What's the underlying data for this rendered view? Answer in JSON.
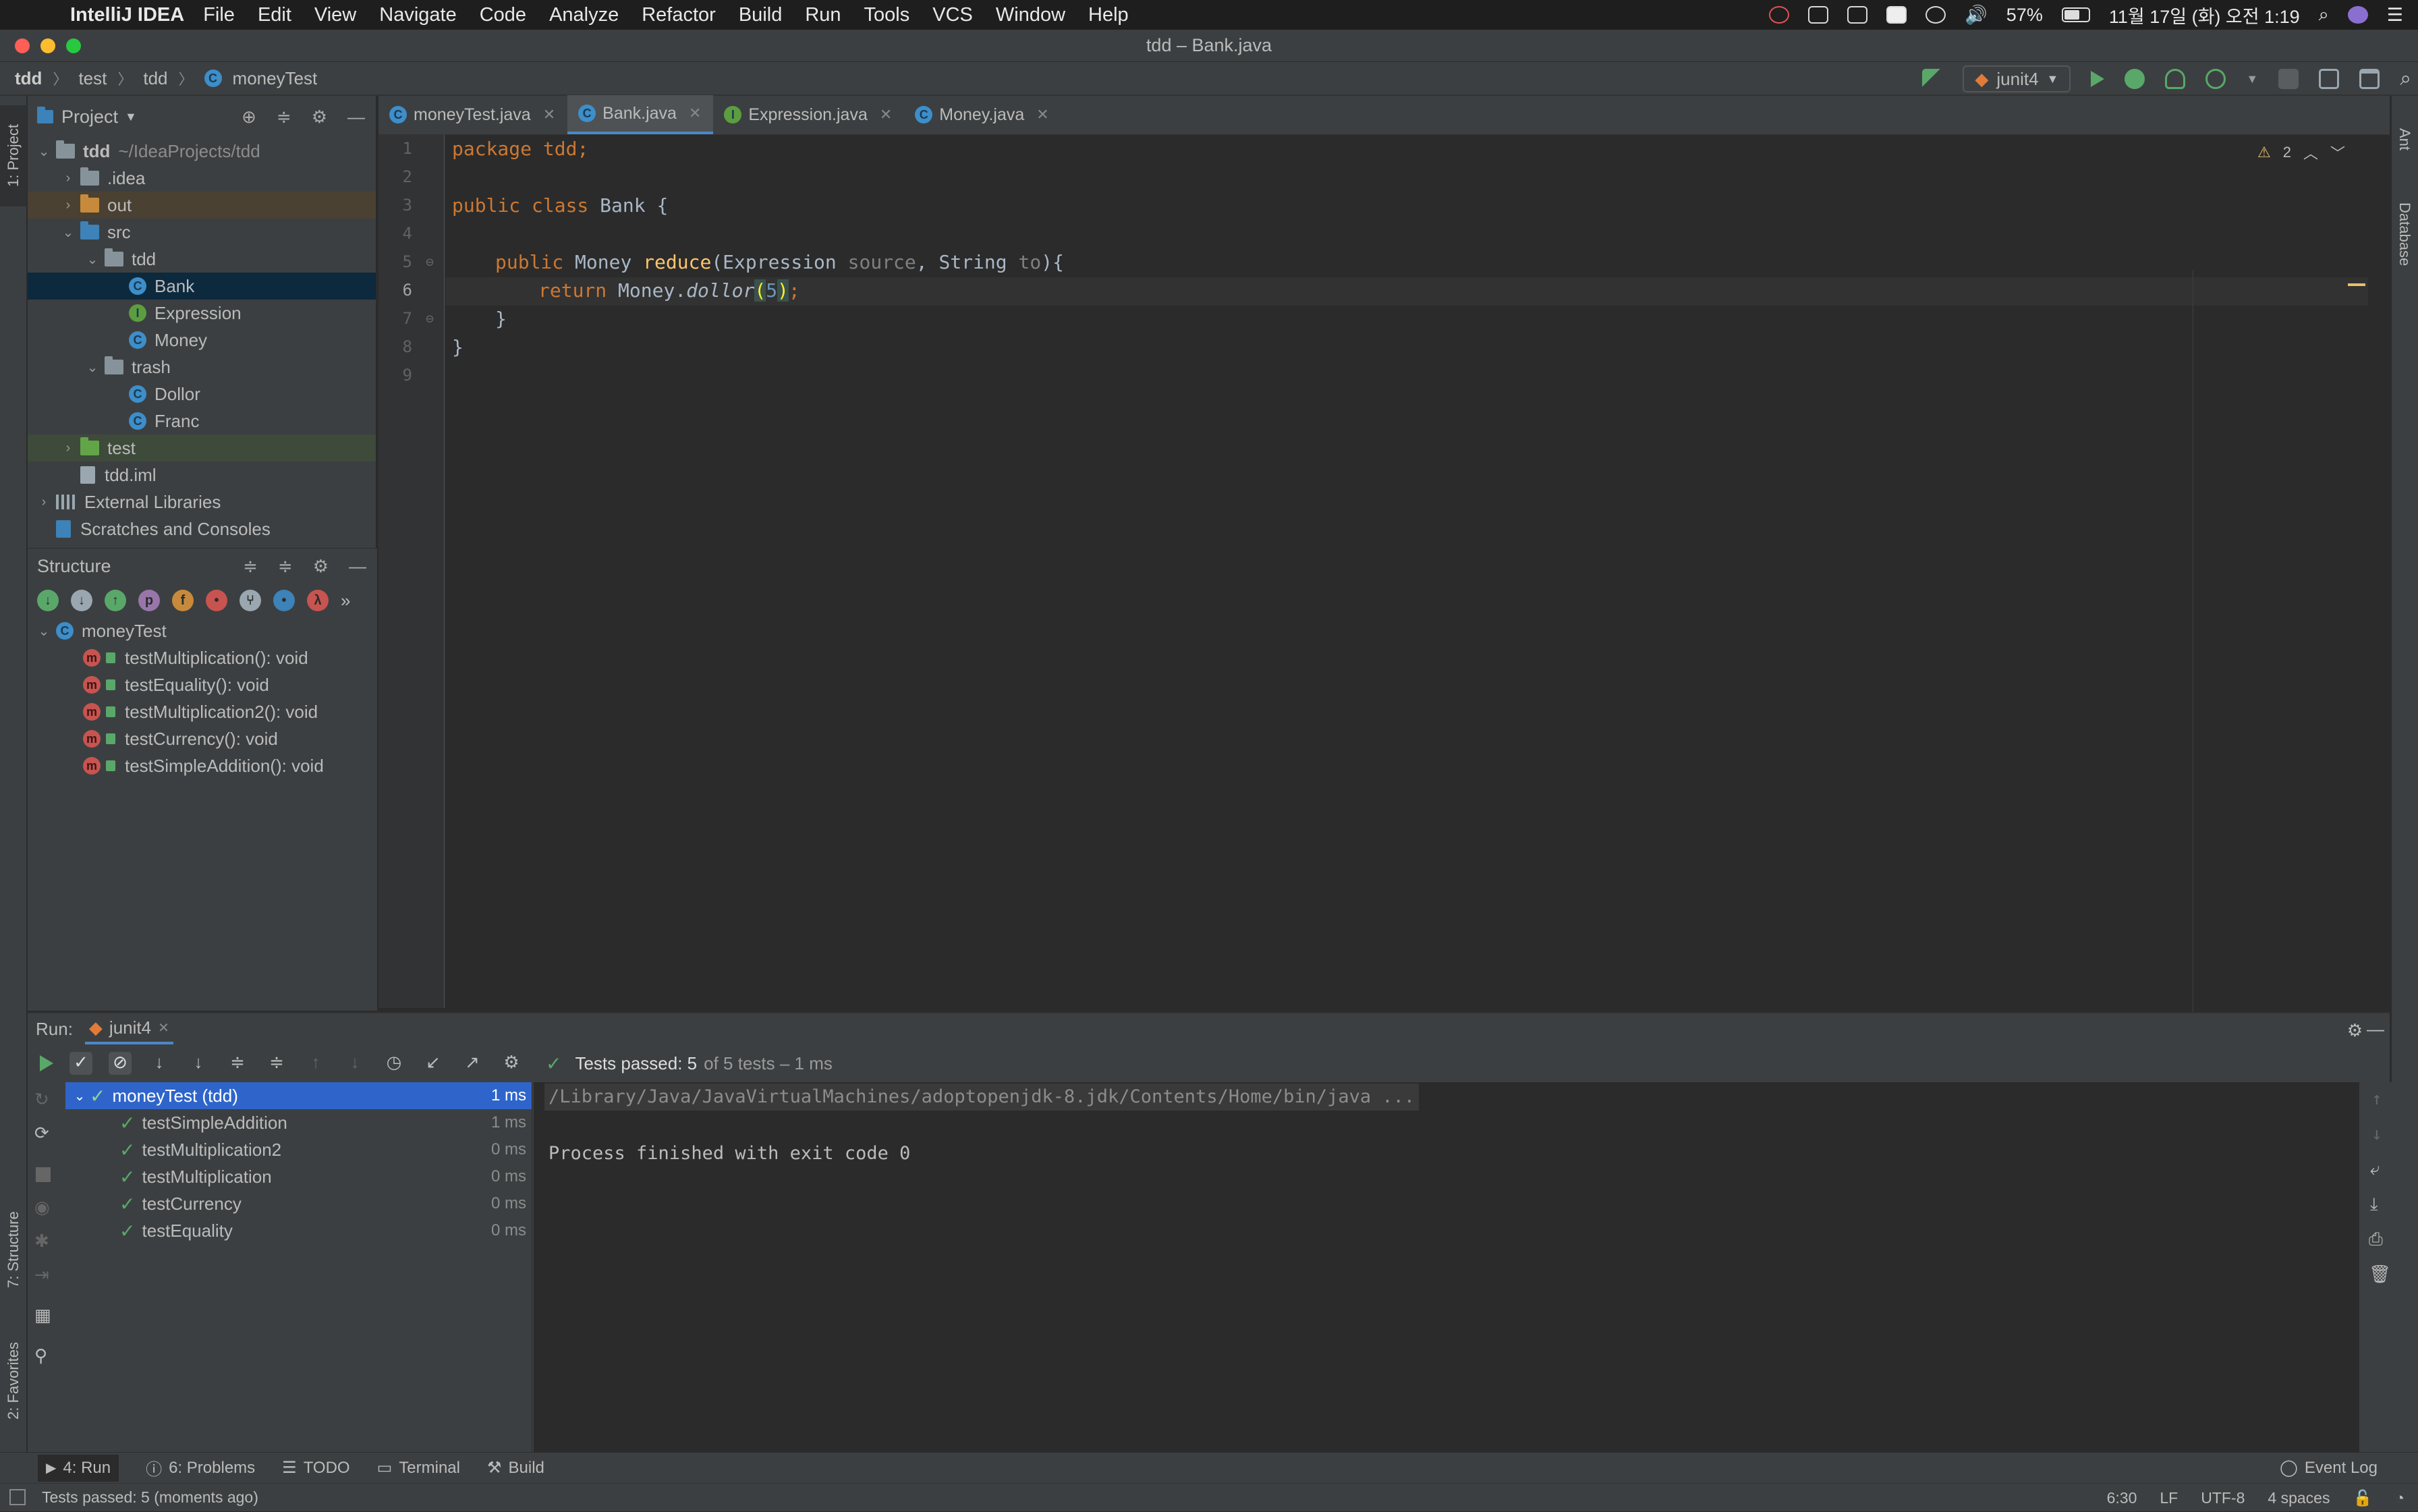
{
  "menubar": {
    "app_name": "IntelliJ IDEA",
    "menus": [
      "File",
      "Edit",
      "View",
      "Navigate",
      "Code",
      "Analyze",
      "Refactor",
      "Build",
      "Run",
      "Tools",
      "VCS",
      "Window",
      "Help"
    ],
    "battery": "57%",
    "clock": "11월 17일 (화) 오전 1:19"
  },
  "window": {
    "title": "tdd – Bank.java"
  },
  "navbar": {
    "breadcrumbs": [
      "tdd",
      "test",
      "tdd",
      "moneyTest"
    ],
    "run_config": "junit4"
  },
  "left_stripe": {
    "project_tab": "1: Project",
    "structure_tab": "7: Structure",
    "favorites_tab": "2: Favorites"
  },
  "right_stripe": {
    "ant_tab": "Ant",
    "database_tab": "Database"
  },
  "project": {
    "title": "Project",
    "root_name": "tdd",
    "root_path": "~/IdeaProjects/tdd",
    "items": {
      "idea": ".idea",
      "out": "out",
      "src": "src",
      "pkg_tdd": "tdd",
      "bank": "Bank",
      "expression": "Expression",
      "money": "Money",
      "trash": "trash",
      "dollor": "Dollor",
      "franc": "Franc",
      "test": "test",
      "iml": "tdd.iml",
      "ext_libs": "External Libraries",
      "scratches": "Scratches and Consoles"
    }
  },
  "structure": {
    "title": "Structure",
    "class_name": "moneyTest",
    "methods": [
      "testMultiplication(): void",
      "testEquality(): void",
      "testMultiplication2(): void",
      "testCurrency(): void",
      "testSimpleAddition(): void"
    ]
  },
  "editor": {
    "tabs": [
      "moneyTest.java",
      "Bank.java",
      "Expression.java",
      "Money.java"
    ],
    "active_tab": "Bank.java",
    "warning_count": "2",
    "line_numbers": [
      "1",
      "2",
      "3",
      "4",
      "5",
      "6",
      "7",
      "8",
      "9"
    ],
    "code": {
      "l1_kw": "package",
      "l1_rest": " tdd;",
      "l3_kw": "public class",
      "l3_rest": " Bank {",
      "l5_kw": "public",
      "l5_type": " Money ",
      "l5_fn": "reduce",
      "l5_a": "(Expression ",
      "l5_p1": "source",
      "l5_b": ", String ",
      "l5_p2": "to",
      "l5_c": "){",
      "l6_kw": "return",
      "l6_a": " Money.",
      "l6_fn": "dollor",
      "l6_open": "(",
      "l6_num": "5",
      "l6_close": ")",
      "l6_end": ";",
      "l7": "}",
      "l8": "}"
    }
  },
  "run": {
    "label": "Run:",
    "tab": "junit4",
    "status_passed": "Tests passed: 5",
    "status_rest": "of 5 tests – 1 ms",
    "root": {
      "name": "moneyTest (tdd)",
      "time": "1 ms"
    },
    "tests": [
      {
        "name": "testSimpleAddition",
        "time": "1 ms"
      },
      {
        "name": "testMultiplication2",
        "time": "0 ms"
      },
      {
        "name": "testMultiplication",
        "time": "0 ms"
      },
      {
        "name": "testCurrency",
        "time": "0 ms"
      },
      {
        "name": "testEquality",
        "time": "0 ms"
      }
    ],
    "console": {
      "cmd": "/Library/Java/JavaVirtualMachines/adoptopenjdk-8.jdk/Contents/Home/bin/java ...",
      "exit": "Process finished with exit code 0"
    }
  },
  "bottom_tabs": {
    "run": "4: Run",
    "problems": "6: Problems",
    "todo": "TODO",
    "terminal": "Terminal",
    "build": "Build",
    "event_log": "Event Log"
  },
  "statusbar": {
    "message": "Tests passed: 5 (moments ago)",
    "position": "6:30",
    "line_sep": "LF",
    "encoding": "UTF-8",
    "indent": "4 spaces"
  }
}
